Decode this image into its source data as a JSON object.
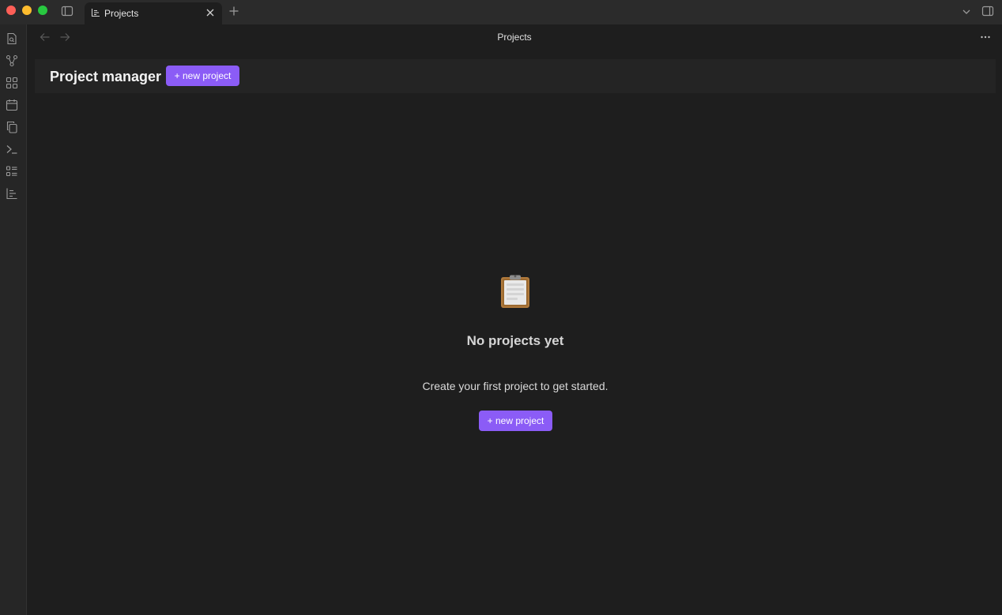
{
  "tabbar": {
    "tab_label": "Projects"
  },
  "view": {
    "title": "Projects"
  },
  "header": {
    "title": "Project manager",
    "new_button_label": "+ new project"
  },
  "empty_state": {
    "icon": "clipboard-icon",
    "title": "No projects yet",
    "description": "Create your first project to get started.",
    "button_label": "+ new project"
  },
  "ribbon": {
    "items": [
      "new-note-icon",
      "graph-view-icon",
      "canvas-icon",
      "daily-note-icon",
      "templates-icon",
      "command-palette-icon",
      "outline-icon",
      "projects-icon"
    ]
  },
  "colors": {
    "accent": "#8b5cf6",
    "background": "#1e1e1e",
    "titlebar": "#2b2b2b"
  }
}
